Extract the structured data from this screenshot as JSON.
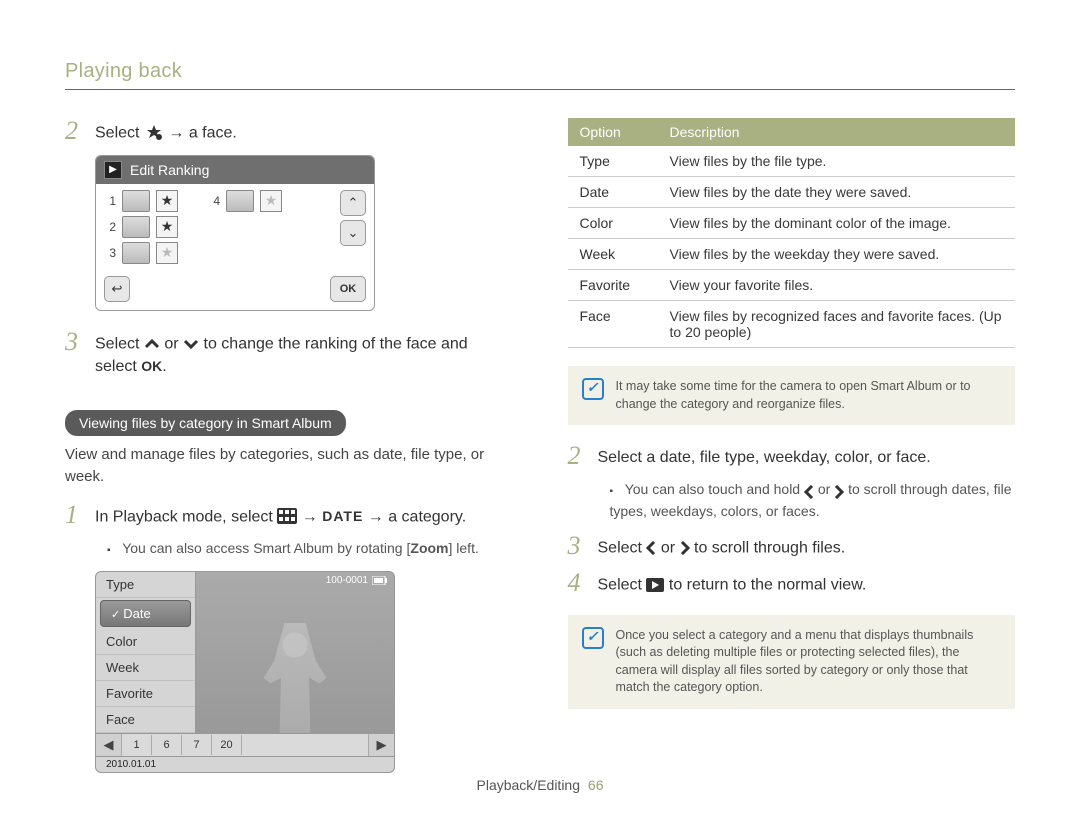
{
  "header": {
    "title": "Playing back"
  },
  "left": {
    "step2": {
      "num": "2",
      "pre": "Select ",
      "post": " → a face."
    },
    "rank": {
      "title": "Edit Ranking",
      "rows": [
        {
          "n": "1",
          "star": true,
          "pair_n": "4",
          "pair_star": false
        },
        {
          "n": "2",
          "star": true
        },
        {
          "n": "3",
          "star": false
        }
      ]
    },
    "step3": {
      "num": "3",
      "pre": "Select ",
      "mid": " or ",
      "post": " to change the ranking of the face and select ",
      "end": "."
    },
    "pill": "Viewing files by category in Smart Album",
    "pill_body": "View and manage files by categories, such as date, file type, or week.",
    "step1b": {
      "num": "1",
      "pre": "In Playback mode, select ",
      "post": " → a category."
    },
    "step1b_sub": "You can also access Smart Album by rotating [",
    "step1b_sub_bold": "Zoom",
    "step1b_sub_end": "] left.",
    "smart": {
      "menu": [
        "Type",
        "Date",
        "Color",
        "Week",
        "Favorite",
        "Face"
      ],
      "selected": "Date",
      "file_no": "100-0001",
      "pages": [
        "1",
        "6",
        "7",
        "20"
      ],
      "date": "2010.01.01"
    }
  },
  "right": {
    "table": {
      "headers": [
        "Option",
        "Description"
      ],
      "rows": [
        [
          "Type",
          "View files by the file type."
        ],
        [
          "Date",
          "View files by the date they were saved."
        ],
        [
          "Color",
          "View files by the dominant color of the image."
        ],
        [
          "Week",
          "View files by the weekday they were saved."
        ],
        [
          "Favorite",
          "View your favorite files."
        ],
        [
          "Face",
          "View files by recognized faces and favorite faces. (Up to 20 people)"
        ]
      ]
    },
    "note1": "It may take some time for the camera to open Smart Album or to change the category and reorganize files.",
    "step2": {
      "num": "2",
      "text": "Select a date, file type, weekday, color, or face."
    },
    "step2_sub_pre": "You can also touch and hold ",
    "step2_sub_mid": " or ",
    "step2_sub_post": " to scroll through dates, file types, weekdays, colors, or faces.",
    "step3": {
      "num": "3",
      "pre": "Select ",
      "mid": " or ",
      "post": " to scroll through files."
    },
    "step4": {
      "num": "4",
      "pre": "Select ",
      "post": " to return to the normal view."
    },
    "note2": "Once you select a category and a menu that displays thumbnails (such as deleting multiple files or protecting selected files), the camera will display all files sorted by category or only those that match the category option."
  },
  "footer": {
    "section": "Playback/Editing",
    "page": "66"
  },
  "icons": {
    "date_label": "DATE",
    "ok_label": "OK"
  }
}
